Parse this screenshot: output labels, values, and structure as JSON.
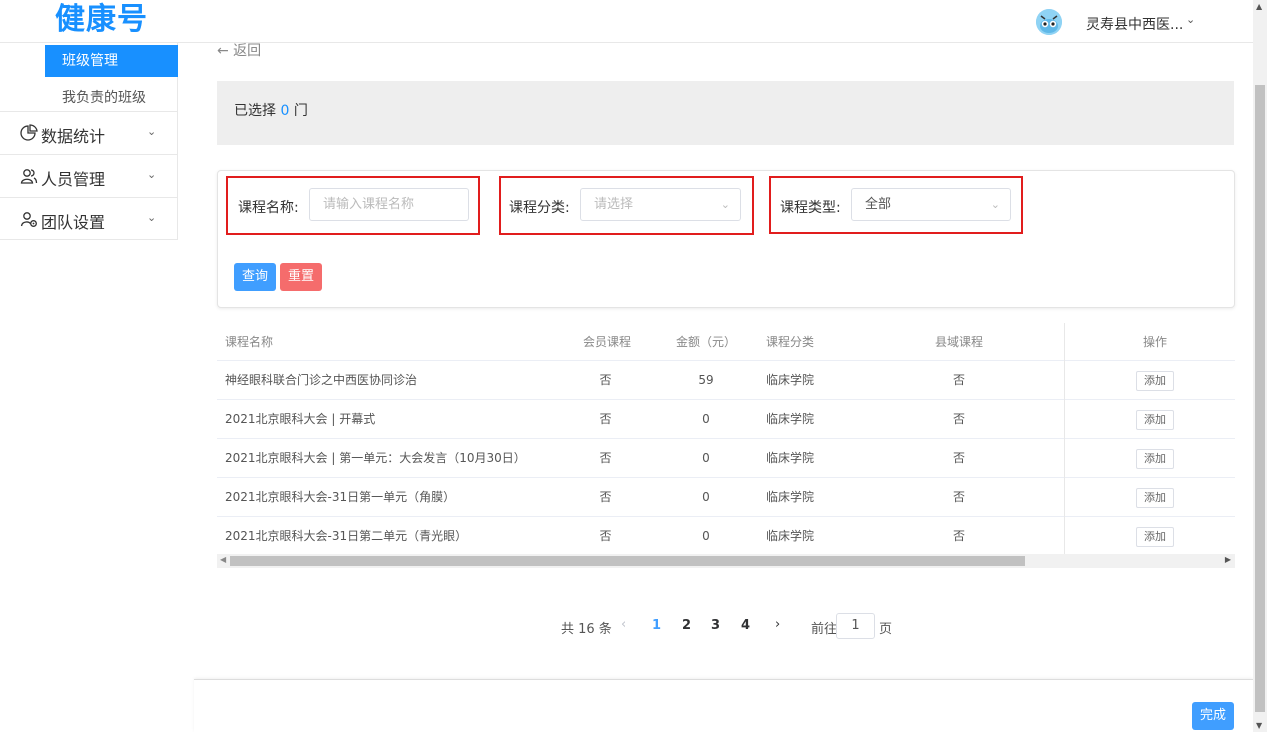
{
  "app": {
    "logo": "健康号"
  },
  "header": {
    "user_name": "灵寿县中西医...",
    "chevron": "⌄"
  },
  "sidebar": {
    "active_item": "班级管理",
    "sub_item": "我负责的班级",
    "groups": [
      {
        "label": "数据统计",
        "icon": "pie-chart-icon"
      },
      {
        "label": "人员管理",
        "icon": "users-icon"
      },
      {
        "label": "团队设置",
        "icon": "team-settings-icon"
      }
    ]
  },
  "nav": {
    "back_label": "← 返回"
  },
  "selection": {
    "prefix": "已选择 ",
    "count": "0",
    "suffix": " 门"
  },
  "filters": {
    "course_name": {
      "label": "课程名称:",
      "placeholder": "请输入课程名称"
    },
    "course_category": {
      "label": "课程分类:",
      "placeholder": "请选择"
    },
    "course_type": {
      "label": "课程类型:",
      "value": "全部"
    },
    "query_label": "查询",
    "reset_label": "重置"
  },
  "table": {
    "columns": [
      "课程名称",
      "会员课程",
      "金额（元）",
      "课程分类",
      "县域课程",
      "操作"
    ],
    "add_label": "添加",
    "rows": [
      {
        "name": "神经眼科联合门诊之中西医协同诊治",
        "member": "否",
        "amount": "59",
        "category": "临床学院",
        "county": "否"
      },
      {
        "name": "2021北京眼科大会 | 开幕式",
        "member": "否",
        "amount": "0",
        "category": "临床学院",
        "county": "否"
      },
      {
        "name": "2021北京眼科大会 | 第一单元：大会发言（10月30日）",
        "member": "否",
        "amount": "0",
        "category": "临床学院",
        "county": "否"
      },
      {
        "name": "2021北京眼科大会-31日第一单元（角膜）",
        "member": "否",
        "amount": "0",
        "category": "临床学院",
        "county": "否"
      },
      {
        "name": "2021北京眼科大会-31日第二单元（青光眼）",
        "member": "否",
        "amount": "0",
        "category": "临床学院",
        "county": "否"
      }
    ]
  },
  "pagination": {
    "total_text": "共 16 条",
    "prev": "‹",
    "next": "›",
    "pages": [
      "1",
      "2",
      "3",
      "4"
    ],
    "current": "1",
    "goto_prefix": "前往",
    "goto_value": "1",
    "goto_suffix": "页"
  },
  "footer": {
    "done_label": "完成"
  },
  "colors": {
    "primary": "#1890ff",
    "danger": "#f56c6c",
    "highlight": "#e11d1d"
  }
}
